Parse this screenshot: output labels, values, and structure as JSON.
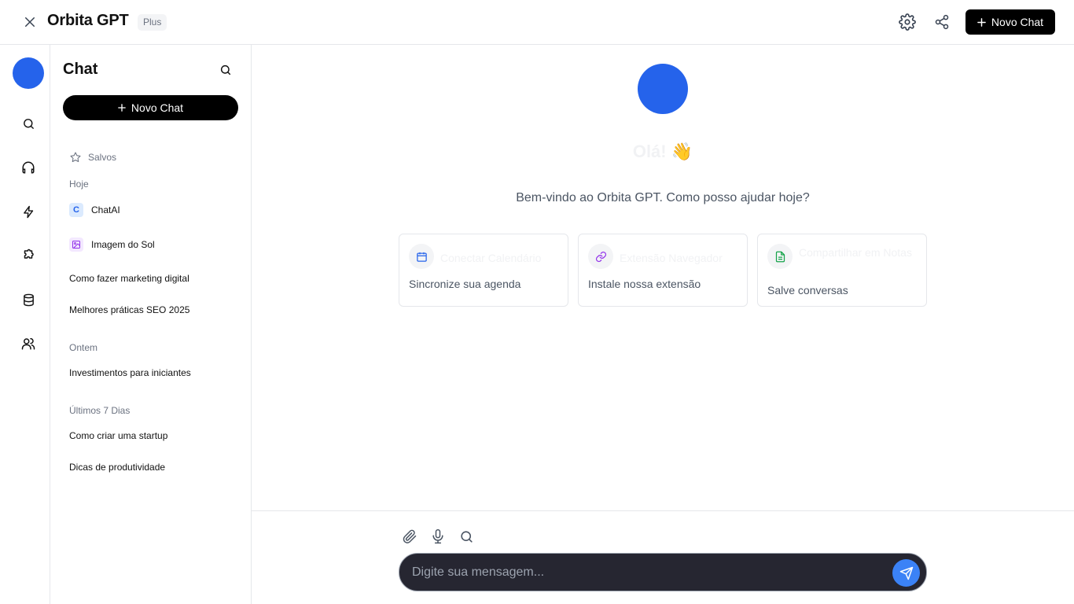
{
  "header": {
    "title": "Orbita GPT",
    "badge": "Plus",
    "new_chat_label": "Novo Chat",
    "icons": [
      "close-icon",
      "gear-icon",
      "share-icon",
      "plus-icon"
    ]
  },
  "rail": {
    "icons": [
      "search-icon",
      "headphones-icon",
      "lightning-icon",
      "puzzle-icon",
      "database-icon",
      "users-icon"
    ]
  },
  "sidebar": {
    "title": "Chat",
    "new_chat_label": "Novo Chat",
    "saved_label": "Salvos",
    "sections": [
      {
        "label": "Hoje",
        "items": [
          {
            "label": "ChatAI",
            "icon": "C"
          },
          {
            "label": "Imagem do Sol",
            "icon": "image-icon"
          },
          {
            "label": "Como fazer marketing digital"
          },
          {
            "label": "Melhores práticas SEO 2025"
          }
        ]
      },
      {
        "label": "Ontem",
        "items": [
          {
            "label": "Investimentos para iniciantes"
          }
        ]
      },
      {
        "label": "Últimos 7 Dias",
        "items": [
          {
            "label": "Como criar uma startup"
          },
          {
            "label": "Dicas de produtividade"
          }
        ]
      }
    ]
  },
  "main": {
    "greeting": "Olá!",
    "greeting_emoji": "👋",
    "welcome": "Bem-vindo ao Orbita GPT. Como posso ajudar hoje?",
    "cards": [
      {
        "title": "Conectar Calendário",
        "description": "Sincronize sua agenda",
        "icon": "calendar-icon",
        "color": "#2563eb"
      },
      {
        "title": "Extensão Navegador",
        "description": "Instale nossa extensão",
        "icon": "link-icon",
        "color": "#9333ea"
      },
      {
        "title": "Compartilhar em Notas",
        "description": "Salve conversas",
        "icon": "document-icon",
        "color": "#16a34a"
      }
    ]
  },
  "composer": {
    "placeholder": "Digite sua mensagem...",
    "tools": [
      "paperclip-icon",
      "microphone-icon",
      "search-icon"
    ]
  },
  "colors": {
    "accent": "#2563eb",
    "send": "#3b82f6",
    "input_bg": "#262631"
  }
}
